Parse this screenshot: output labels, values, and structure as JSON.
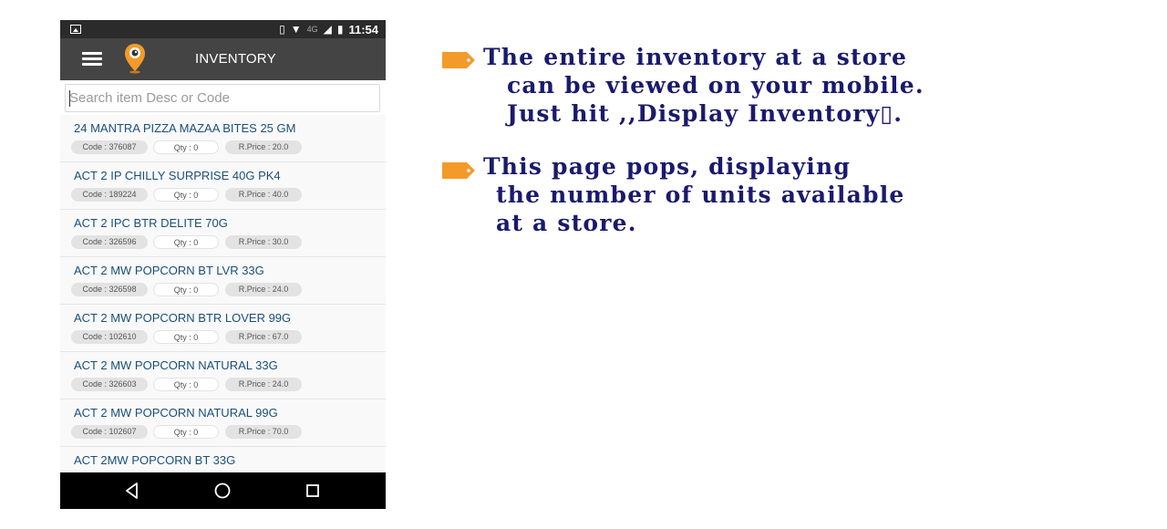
{
  "status_bar": {
    "network": "4G",
    "time": "11:54"
  },
  "app_bar": {
    "title": "INVENTORY"
  },
  "search": {
    "placeholder": "Search item Desc or Code",
    "value": ""
  },
  "items": [
    {
      "name": "24 MANTRA PIZZA MAZAA BITES 25 GM",
      "code": "Code : 376087",
      "qty": "Qty : 0",
      "price": "R.Price : 20.0"
    },
    {
      "name": "ACT 2 IP CHILLY SURPRISE 40G PK4",
      "code": "Code : 189224",
      "qty": "Qty : 0",
      "price": "R.Price : 40.0"
    },
    {
      "name": "ACT 2 IPC BTR DELITE 70G",
      "code": "Code : 326596",
      "qty": "Qty : 0",
      "price": "R.Price : 30.0"
    },
    {
      "name": "ACT 2 MW POPCORN BT LVR 33G",
      "code": "Code : 326598",
      "qty": "Qty : 0",
      "price": "R.Price : 24.0"
    },
    {
      "name": "ACT 2 MW POPCORN BTR LOVER 99G",
      "code": "Code : 102610",
      "qty": "Qty : 0",
      "price": "R.Price : 67.0"
    },
    {
      "name": "ACT 2 MW POPCORN NATURAL 33G",
      "code": "Code : 326603",
      "qty": "Qty : 0",
      "price": "R.Price : 24.0"
    },
    {
      "name": "ACT 2 MW POPCORN NATURAL 99G",
      "code": "Code : 102607",
      "qty": "Qty : 0",
      "price": "R.Price : 70.0"
    },
    {
      "name": "ACT 2MW POPCORN BT 33G"
    }
  ],
  "icons": {
    "status_left": "image-notification-icon",
    "status_right": [
      "vibrate-icon",
      "wifi-icon",
      "signal-icon",
      "battery-icon"
    ],
    "app_bar": [
      "menu-icon",
      "location-pin-logo-icon"
    ],
    "nav": [
      "back-icon",
      "home-icon",
      "recents-icon"
    ],
    "bullets": "tag-icon"
  },
  "colors": {
    "app_bar": "#444444",
    "status_bar": "#2b2b2b",
    "item_name": "#1a4f78",
    "bullet_text": "#1a1a6e",
    "bullet_tag": "#f39a2b",
    "logo": "#f39a2b"
  },
  "bullets": [
    {
      "lines": [
        "The entire inventory at a store",
        "can  be viewed on  your mobile.",
        "Just hit ,,Display Inventory▯."
      ]
    },
    {
      "lines": [
        "This page pops, displaying",
        "the number of units available",
        "at a store."
      ]
    }
  ]
}
